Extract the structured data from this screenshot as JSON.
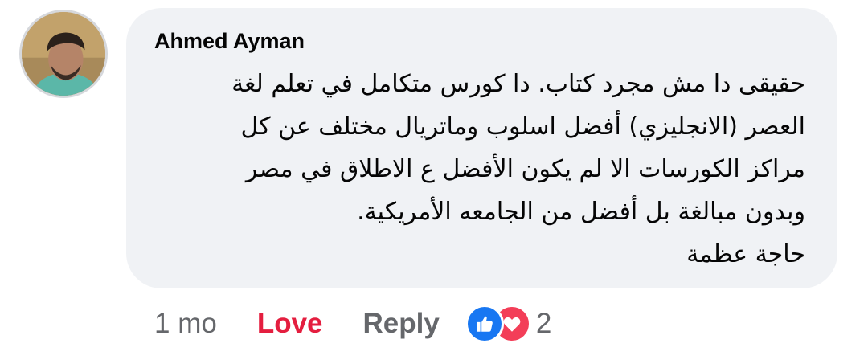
{
  "comment": {
    "author": "Ahmed Ayman",
    "text": "حقيقى دا مش مجرد كتاب. دا كورس متكامل في تعلم لغة\nالعصر (الانجليزي) أفضل اسلوب وماتريال مختلف عن كل\nمراكز الكورسات الا لم يكون الأفضل ع الاطلاق في مصر\nوبدون مبالغة بل أفضل من الجامعه الأمريكية.\nحاجة عظمة"
  },
  "actions": {
    "time": "1 mo",
    "reaction_label": "Love",
    "reply_label": "Reply",
    "reaction_count": "2"
  },
  "icons": {
    "reactions": [
      "like-icon",
      "love-heart-icon"
    ],
    "avatar": "profile-photo"
  },
  "colors": {
    "bubble_bg": "#f0f2f5",
    "love": "#e41e3f",
    "like": "#1877f2",
    "heart": "#f33e58",
    "secondary_text": "#65676b"
  }
}
